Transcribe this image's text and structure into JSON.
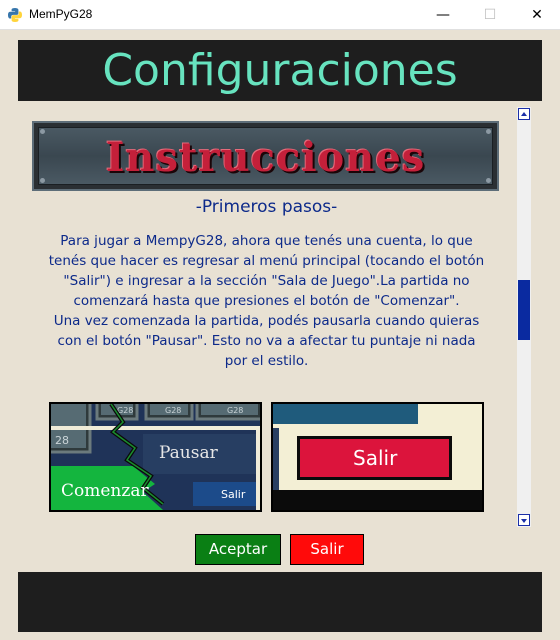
{
  "window": {
    "title": "MemPyG28",
    "minimize_glyph": "—",
    "maximize_glyph": "☐",
    "close_glyph": "✕"
  },
  "header": {
    "title": "Configuraciones",
    "title_color": "#67e3bf"
  },
  "content": {
    "banner_text": "Instrucciones",
    "subtitle": "-Primeros pasos-",
    "paragraph_lines": [
      "Para jugar a MempyG28, ahora que tenés una cuenta, lo que",
      "tenés que hacer es regresar al menú principal (tocando el botón",
      "\"Salir\") e ingresar a la sección \"Sala de Juego\".La partida no",
      "comenzará hasta que presiones el botón de \"Comenzar\".",
      "Una vez comenzada la partida, podés pausarla cuando quieras",
      "con el botón \"Pausar\". Esto no va a afectar tu puntaje ni nada",
      "por el estilo."
    ],
    "text_color": "#0d2a8a",
    "image_left": {
      "pausar_label": "Pausar",
      "comenzar_label": "Comenzar",
      "salir_label": "Salir",
      "tile_labels": [
        "G28",
        "G28",
        "G28",
        "28"
      ]
    },
    "image_right": {
      "salir_label": "Salir"
    }
  },
  "scrollbar": {
    "position_fraction": 0.48
  },
  "buttons": {
    "accept_label": "Aceptar",
    "accept_color": "#0a7f14",
    "exit_label": "Salir",
    "exit_color": "#ff0a0a"
  }
}
